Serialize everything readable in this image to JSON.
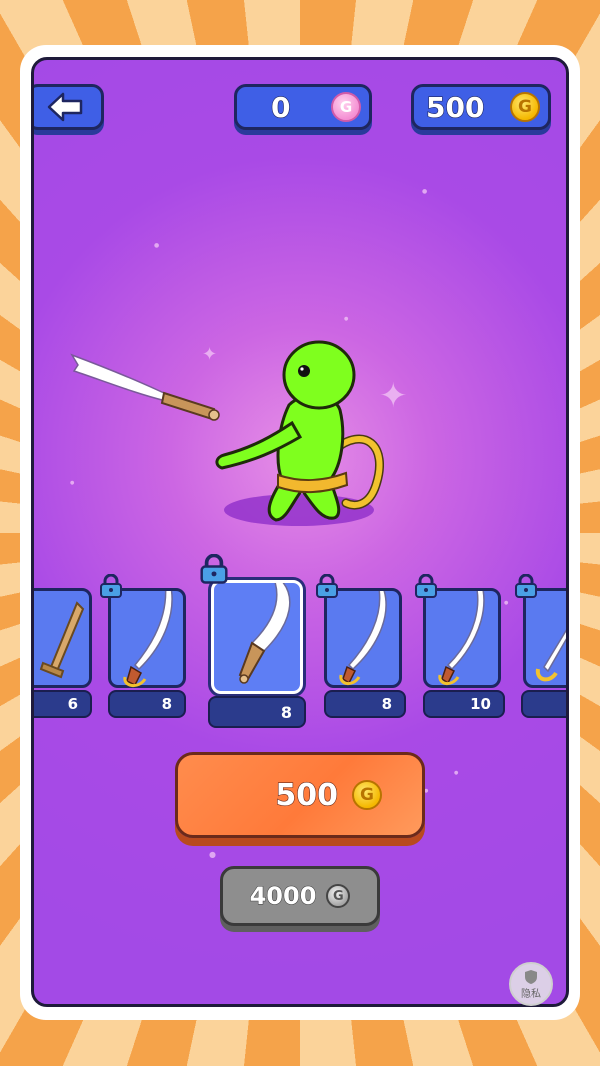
{
  "header": {
    "gems": "0",
    "gem_symbol": "G",
    "coins": "500",
    "coin_symbol": "G"
  },
  "weapons": [
    {
      "level": "6",
      "locked": false
    },
    {
      "level": "8",
      "locked": true
    },
    {
      "level": "8",
      "locked": true,
      "selected": true
    },
    {
      "level": "8",
      "locked": true
    },
    {
      "level": "10",
      "locked": true
    },
    {
      "level": "",
      "locked": true
    }
  ],
  "buy_button": {
    "price": "500",
    "coin_symbol": "G"
  },
  "alt_button": {
    "price": "4000",
    "coin_symbol": "G"
  },
  "privacy": {
    "label": "隐私"
  },
  "colors": {
    "background_purple": "#a94ae6",
    "character_green": "#7fff1e",
    "buy_orange": "#ff7a3a",
    "pill_blue": "#3f5fe6"
  }
}
